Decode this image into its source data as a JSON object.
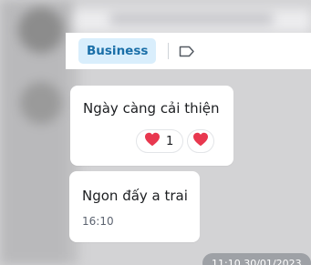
{
  "tag_bar": {
    "tag_label": "Business",
    "tag_icon": "label-tag-icon"
  },
  "messages": [
    {
      "text": "Ngày càng cải thiện",
      "reactions": [
        {
          "icon": "heart-icon",
          "count": "1"
        },
        {
          "icon": "heart-icon"
        }
      ]
    },
    {
      "text": "Ngon đấy a trai",
      "time": "16:10"
    }
  ],
  "date_separator": "11:10 30/01/2023",
  "colors": {
    "tag_background": "#d9eefc",
    "tag_text": "#1a6fa8",
    "heart": "#e8384f",
    "chat_background": "#d3d3d5"
  }
}
